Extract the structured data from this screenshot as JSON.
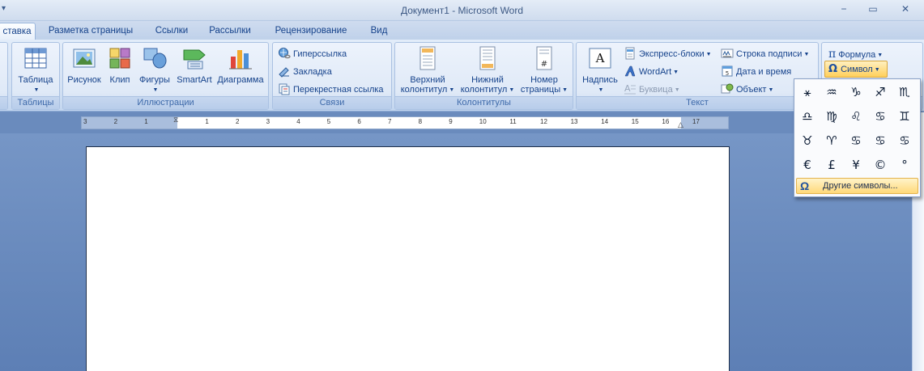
{
  "window": {
    "title": "Документ1 - Microsoft Word",
    "minimize": "−",
    "maximize": "▭",
    "close": "✕",
    "qa": "▾"
  },
  "tabs": [
    {
      "label": "ставка",
      "active": true
    },
    {
      "label": "Разметка страницы"
    },
    {
      "label": "Ссылки"
    },
    {
      "label": "Рассылки"
    },
    {
      "label": "Рецензирование"
    },
    {
      "label": "Вид"
    }
  ],
  "groups": {
    "tables": {
      "label": "Таблицы",
      "table_btn": "Таблица"
    },
    "illustrations": {
      "label": "Иллюстрации",
      "picture": "Рисунок",
      "clip": "Клип",
      "shapes": "Фигуры",
      "smartart": "SmartArt",
      "chart": "Диаграмма"
    },
    "links": {
      "label": "Связи",
      "hyperlink": "Гиперссылка",
      "bookmark": "Закладка",
      "crossref": "Перекрестная ссылка"
    },
    "headers": {
      "label": "Колонтитулы",
      "header_l1": "Верхний",
      "header_l2": "колонтитул",
      "footer_l1": "Нижний",
      "footer_l2": "колонтитул",
      "pagenum_l1": "Номер",
      "pagenum_l2": "страницы"
    },
    "text": {
      "label": "Текст",
      "textbox": "Надпись",
      "quickparts": "Экспресс-блоки",
      "wordart": "WordArt",
      "dropcap": "Буквица",
      "signature": "Строка подписи",
      "datetime": "Дата и время",
      "object": "Объект"
    },
    "symbols": {
      "equation": "Формула",
      "symbol": "Символ"
    }
  },
  "ruler": {
    "ticks": [
      "3",
      "2",
      "1",
      "",
      "1",
      "2",
      "3",
      "4",
      "5",
      "6",
      "7",
      "8",
      "9",
      "10",
      "11",
      "12",
      "13",
      "14",
      "15",
      "16",
      "17"
    ]
  },
  "symbol_menu": {
    "symbols": [
      "⚹",
      "♒",
      "♑",
      "♐",
      "♏",
      "♎",
      "♍",
      "♌",
      "♋",
      "♊",
      "♉",
      "♈",
      "♋",
      "♋",
      "♋",
      "€",
      "£",
      "¥",
      "©",
      "°"
    ],
    "more_label": "Другие символы..."
  },
  "colors": {
    "accent": "#15428b",
    "ribbon_bg": "#dfe9f7",
    "highlight": "#ffd97a",
    "doc_bg": "#6f8fbf"
  }
}
